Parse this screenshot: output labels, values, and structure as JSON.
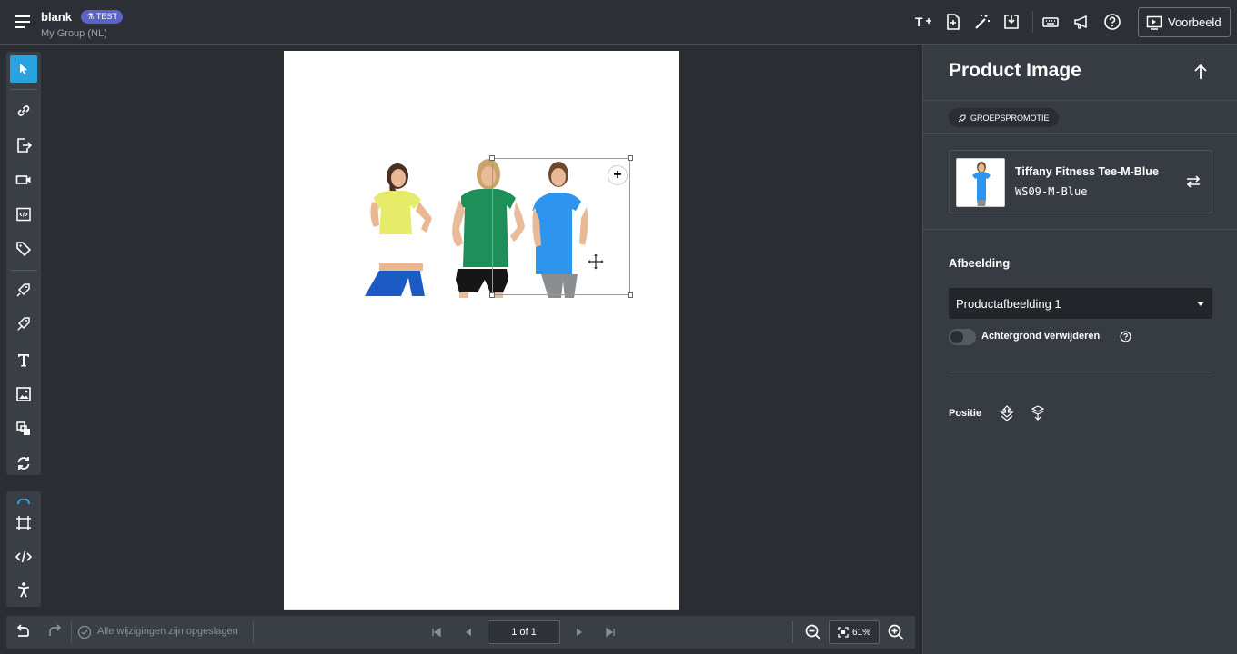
{
  "header": {
    "title": "blank",
    "badge": "TEST",
    "subtitle": "My Group (NL)",
    "icons": [
      "text-add-icon",
      "document-add-icon",
      "magic-wand-icon",
      "download-icon",
      "keyboard-icon",
      "megaphone-icon",
      "help-icon"
    ],
    "preview_label": "Voorbeeld"
  },
  "left_toolbar": {
    "tools": [
      "select-pointer-icon",
      "link-icon",
      "export-icon",
      "video-icon",
      "html-code-icon",
      "tag-icon",
      "price-tag-icon",
      "price-tag-edit-icon",
      "text-icon",
      "image-icon",
      "layers-icon",
      "refresh-icon",
      "frame-icon",
      "code-icon",
      "accessibility-icon"
    ]
  },
  "canvas": {
    "product_image_alt": "Three women wearing fitness tees"
  },
  "bottom_bar": {
    "saved_status": "Alle wijzigingen zijn opgeslagen",
    "page_indicator": "1 of 1",
    "zoom_level": "61%"
  },
  "right_panel": {
    "title": "Product Image",
    "group_badge": "GROEPSPROMOTIE",
    "product": {
      "name": "Tiffany Fitness Tee-M-Blue",
      "sku": "WS09-M-Blue"
    },
    "image_section_label": "Afbeelding",
    "image_select_value": "Productafbeelding 1",
    "remove_background_label": "Achtergrond verwijderen",
    "remove_background_on": false,
    "position_label": "Positie"
  },
  "colors": {
    "accent": "#29a3e0",
    "badge": "#5b63c9",
    "panel": "#373b42",
    "shirt_yellow": "#e6ec6a",
    "shirt_green": "#1f8f5a",
    "shirt_blue": "#2e95ee"
  }
}
